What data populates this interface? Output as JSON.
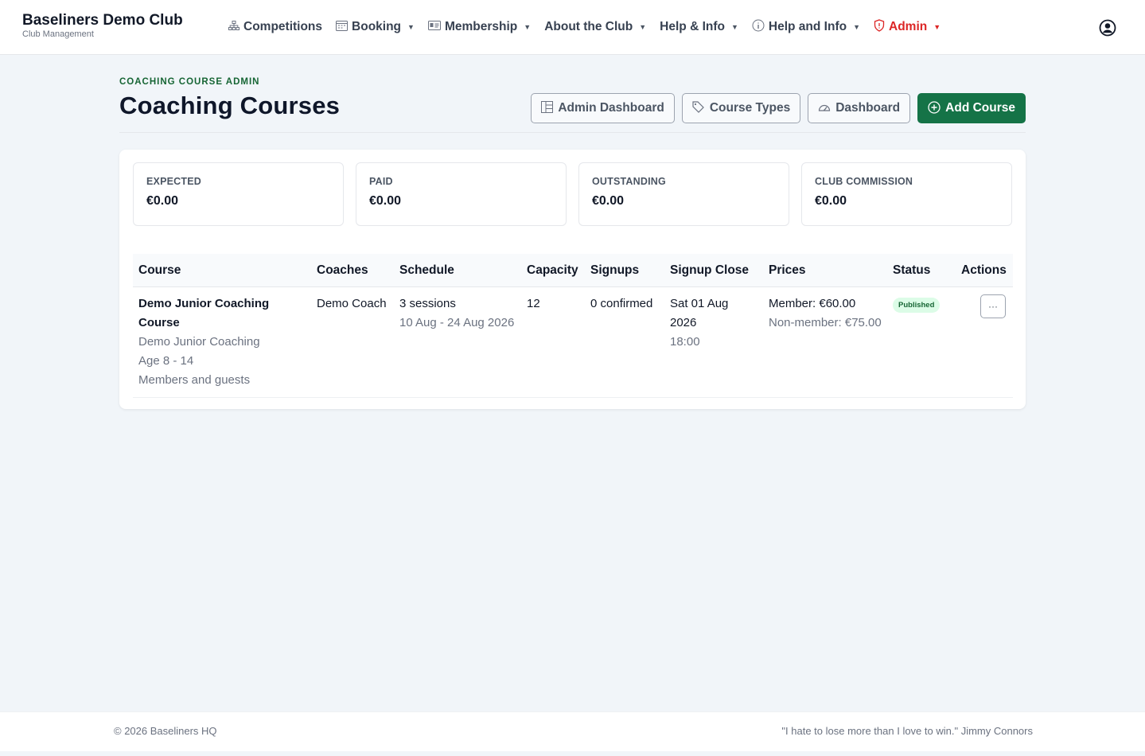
{
  "brand": {
    "name": "Baseliners Demo Club",
    "subtitle": "Club Management"
  },
  "nav": {
    "items": [
      {
        "label": "Competitions",
        "icon": "sitemap-icon",
        "dropdown": false
      },
      {
        "label": "Booking",
        "icon": "calendar-icon",
        "dropdown": true
      },
      {
        "label": "Membership",
        "icon": "id-card-icon",
        "dropdown": true
      },
      {
        "label": "About the Club",
        "icon": "",
        "dropdown": true
      },
      {
        "label": "Help & Info",
        "icon": "",
        "dropdown": true
      },
      {
        "label": "Help and Info",
        "icon": "info-circle-icon",
        "dropdown": true
      },
      {
        "label": "Admin",
        "icon": "shield-icon",
        "dropdown": true
      }
    ],
    "user_icon": "user-circle-icon"
  },
  "header": {
    "eyebrow": "COACHING COURSE ADMIN",
    "title": "Coaching Courses",
    "actions": {
      "admin_dashboard": "Admin Dashboard",
      "course_types": "Course Types",
      "dashboard": "Dashboard",
      "add_course": "Add Course"
    }
  },
  "stats": [
    {
      "label": "EXPECTED",
      "value": "€0.00"
    },
    {
      "label": "PAID",
      "value": "€0.00"
    },
    {
      "label": "OUTSTANDING",
      "value": "€0.00"
    },
    {
      "label": "CLUB COMMISSION",
      "value": "€0.00"
    }
  ],
  "table": {
    "columns": [
      "Course",
      "Coaches",
      "Schedule",
      "Capacity",
      "Signups",
      "Signup Close",
      "Prices",
      "Status",
      "Actions"
    ],
    "rows": [
      {
        "course_name": "Demo Junior Coaching Course",
        "course_type": "Demo Junior Coaching",
        "age": "Age 8 - 14",
        "audience": "Members and guests",
        "coaches": "Demo Coach",
        "sessions": "3 sessions",
        "date_range": "10 Aug - 24 Aug 2026",
        "capacity": "12",
        "signups": "0 confirmed",
        "close_date": "Sat 01 Aug 2026",
        "close_time": "18:00",
        "member_price": "Member: €60.00",
        "nonmember_price": "Non-member: €75.00",
        "status": "Published",
        "actions": "···"
      }
    ]
  },
  "footer": {
    "copyright": "© 2026 Baseliners HQ",
    "quote": "\"I hate to lose more than I love to win.\" Jimmy Connors"
  },
  "colors": {
    "primary": "#157347",
    "admin": "#dc2626",
    "badge_bg": "#dcfce7",
    "background": "#f1f5f9"
  }
}
